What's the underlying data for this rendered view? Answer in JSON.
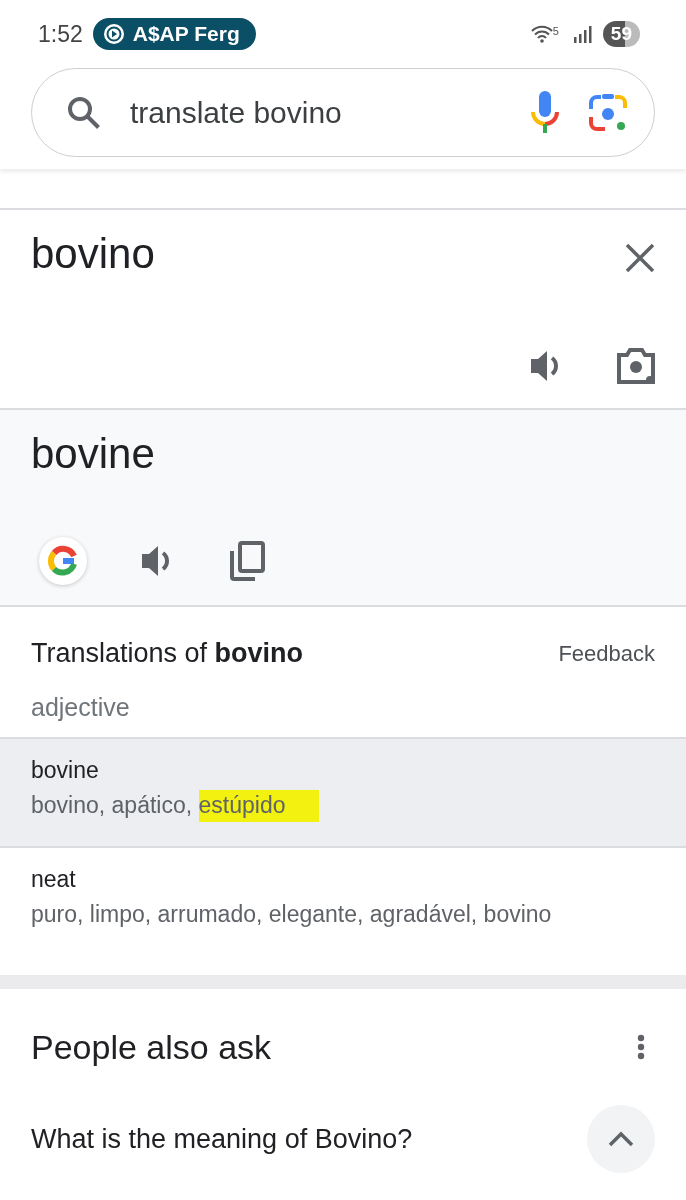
{
  "status_bar": {
    "time": "1:52",
    "media": "A$AP Ferg",
    "wifi_badge": "5",
    "battery": "59"
  },
  "search": {
    "value": "translate bovino"
  },
  "source": {
    "text": "bovino"
  },
  "target": {
    "text": "bovine"
  },
  "dictionary": {
    "title": "Translations of **bovino**",
    "feedback": "Feedback",
    "part_of_speech": "adjective",
    "entries": [
      {
        "word": "bovine",
        "selected": true,
        "meanings": [
          {
            "text": "bovino, apático, ",
            "highlighted": false
          },
          {
            "text": "estúpido",
            "highlighted": true
          }
        ]
      },
      {
        "word": "neat",
        "selected": false,
        "meanings": [
          {
            "text": "puro, limpo, arrumado, elegante, agradável, bovino",
            "highlighted": false
          }
        ]
      }
    ]
  },
  "people_also_ask": {
    "title": "People also ask",
    "questions": [
      {
        "text": "What is the meaning of Bovino?",
        "expanded": true
      }
    ]
  }
}
